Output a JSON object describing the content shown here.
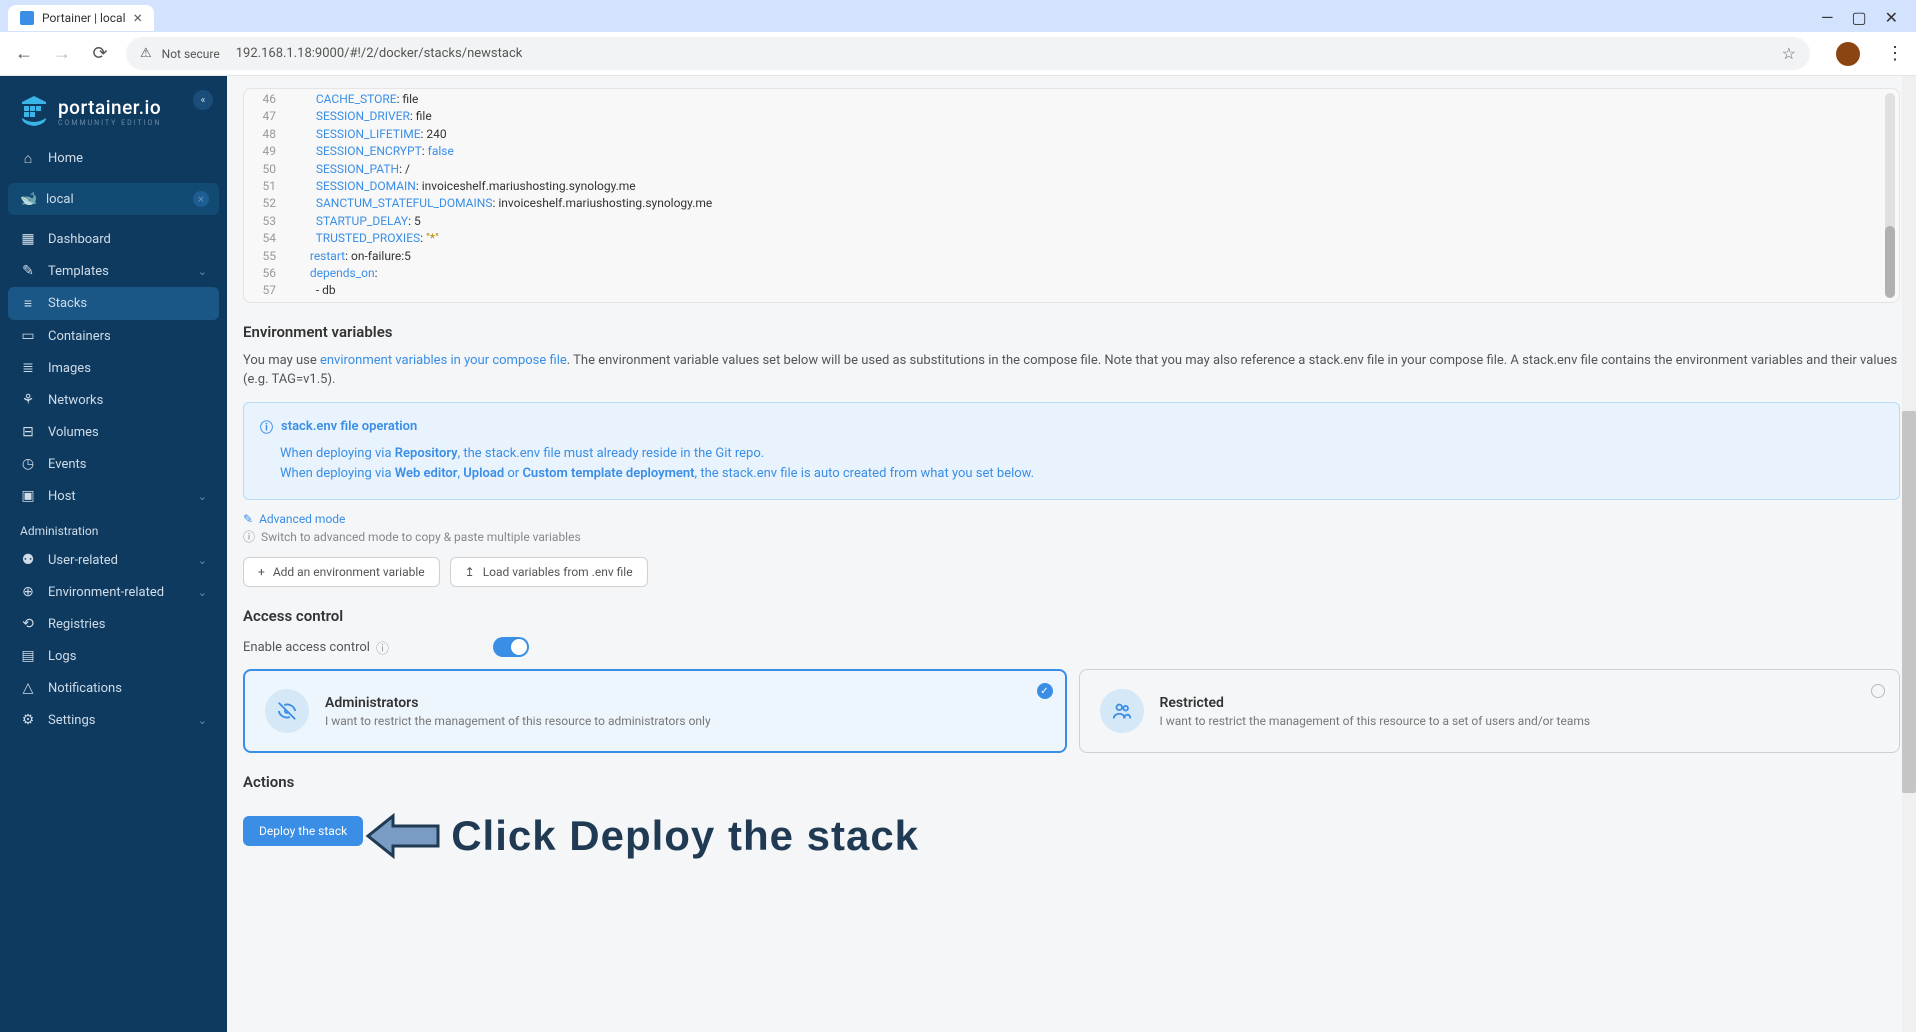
{
  "browser": {
    "tab_title": "Portainer | local",
    "url": "192.168.1.18:9000/#!/2/docker/stacks/newstack",
    "secure_label": "Not secure"
  },
  "logo": {
    "main": "portainer.io",
    "sub": "COMMUNITY EDITION"
  },
  "sidebar": {
    "home": "Home",
    "env_label": "local",
    "items": [
      "Dashboard",
      "Templates",
      "Stacks",
      "Containers",
      "Images",
      "Networks",
      "Volumes",
      "Events",
      "Host"
    ],
    "admin_header": "Administration",
    "admin_items": [
      "User-related",
      "Environment-related",
      "Registries",
      "Logs",
      "Notifications",
      "Settings"
    ]
  },
  "code": {
    "lines": [
      {
        "n": 46,
        "k": "CACHE_STORE",
        "v": "file"
      },
      {
        "n": 47,
        "k": "SESSION_DRIVER",
        "v": "file"
      },
      {
        "n": 48,
        "k": "SESSION_LIFETIME",
        "v": "240"
      },
      {
        "n": 49,
        "k": "SESSION_ENCRYPT",
        "v": "false",
        "bool": true
      },
      {
        "n": 50,
        "k": "SESSION_PATH",
        "v": "/"
      },
      {
        "n": 51,
        "k": "SESSION_DOMAIN",
        "v": "invoiceshelf.mariushosting.synology.me"
      },
      {
        "n": 52,
        "k": "SANCTUM_STATEFUL_DOMAINS",
        "v": "invoiceshelf.mariushosting.synology.me"
      },
      {
        "n": 53,
        "k": "STARTUP_DELAY",
        "v": "5"
      },
      {
        "n": 54,
        "k": "TRUSTED_PROXIES",
        "v": "\"*\"",
        "str": true
      },
      {
        "n": 55,
        "k": "restart",
        "v": "on-failure:5",
        "indent": 2
      },
      {
        "n": 56,
        "k": "depends_on",
        "v": "",
        "indent": 2
      },
      {
        "n": 57,
        "raw": "        - db"
      }
    ]
  },
  "env": {
    "title": "Environment variables",
    "desc_1": "You may use ",
    "desc_link": "environment variables in your compose file",
    "desc_2": ". The environment variable values set below will be used as substitutions in the compose file. Note that you may also reference a stack.env file in your compose file. A stack.env file contains the environment variables and their values (e.g. TAG=v1.5).",
    "info_title": "stack.env file operation",
    "info_line1_a": "When deploying via ",
    "info_line1_b": "Repository",
    "info_line1_c": ", the stack.env file must already reside in the Git repo.",
    "info_line2_a": "When deploying via ",
    "info_line2_b": "Web editor",
    "info_line2_c": ", ",
    "info_line2_d": "Upload",
    "info_line2_e": " or ",
    "info_line2_f": "Custom template deployment",
    "info_line2_g": ", the stack.env file is auto created from what you set below.",
    "advanced": "Advanced mode",
    "advanced_hint": "Switch to advanced mode to copy & paste multiple variables",
    "btn_add": "Add an environment variable",
    "btn_load": "Load variables from .env file"
  },
  "access": {
    "title": "Access control",
    "toggle_label": "Enable access control",
    "admin_title": "Administrators",
    "admin_sub": "I want to restrict the management of this resource to administrators only",
    "restricted_title": "Restricted",
    "restricted_sub": "I want to restrict the management of this resource to a set of users and/or teams"
  },
  "actions": {
    "title": "Actions",
    "deploy": "Deploy the stack"
  },
  "annotation": "Click Deploy the stack"
}
